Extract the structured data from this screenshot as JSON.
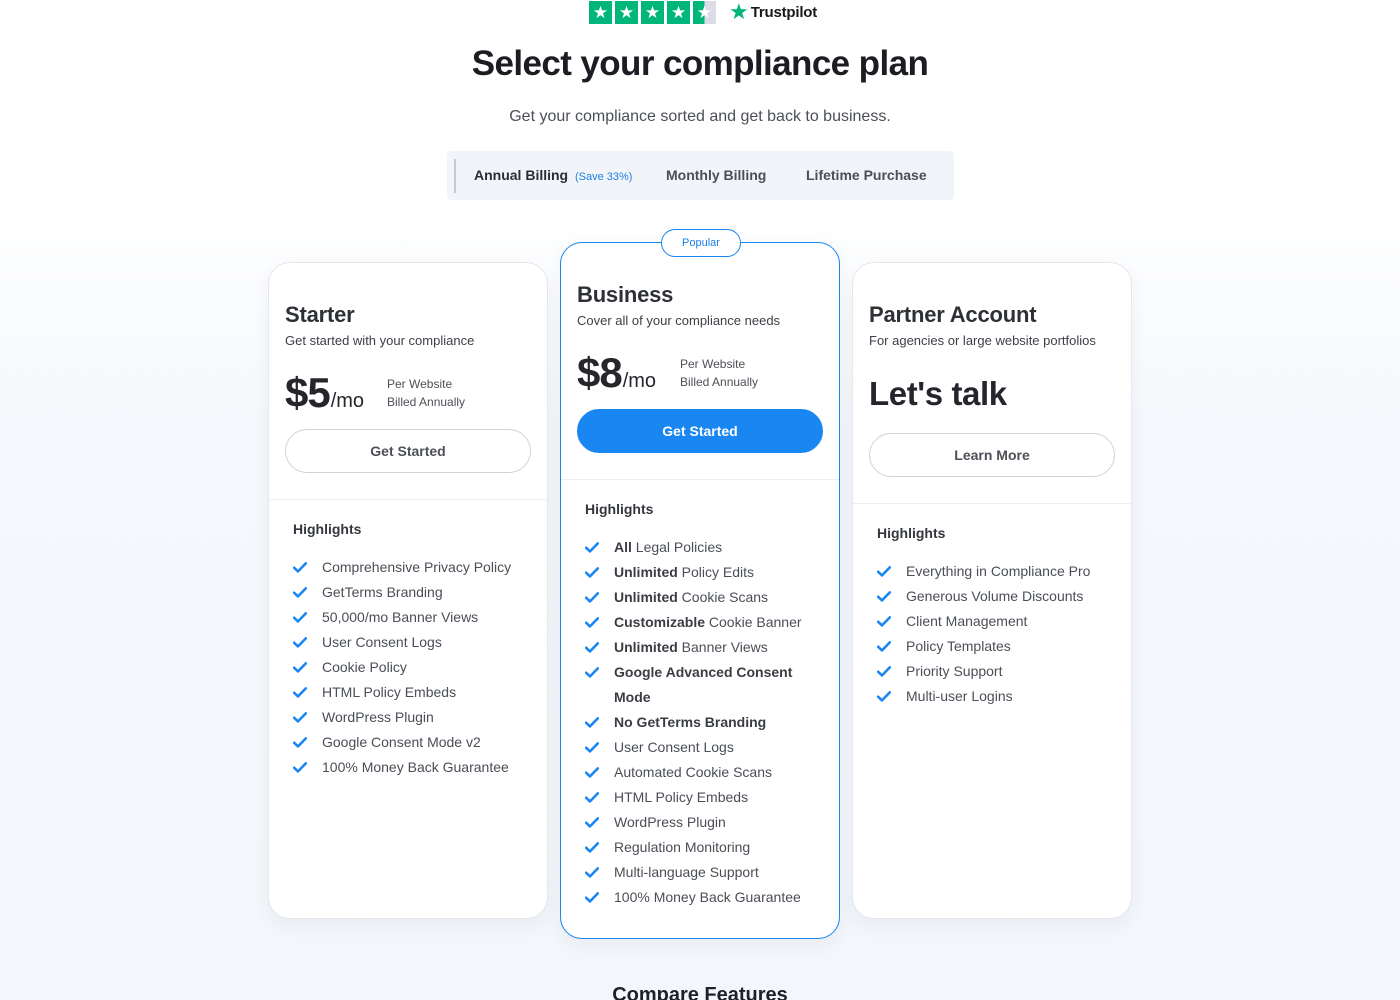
{
  "trustpilot": {
    "brand": "Trustpilot",
    "rating_stars": 4.5
  },
  "header": {
    "title": "Select your compliance plan",
    "subtitle": "Get your compliance sorted and get back to business."
  },
  "billing": {
    "tabs": [
      {
        "label": "Annual Billing",
        "badge": "(Save 33%)",
        "active": true
      },
      {
        "label": "Monthly Billing",
        "active": false
      },
      {
        "label": "Lifetime Purchase",
        "active": false
      }
    ]
  },
  "plans": [
    {
      "name": "Starter",
      "description": "Get started with your compliance",
      "price": "$5",
      "period": "/mo",
      "note_line1": "Per Website",
      "note_line2": "Billed Annually",
      "button": "Get Started",
      "highlights_title": "Highlights",
      "features": [
        {
          "bold": "",
          "text": "Comprehensive Privacy Policy"
        },
        {
          "bold": "",
          "text": "GetTerms Branding"
        },
        {
          "bold": "",
          "text": "50,000/mo Banner Views"
        },
        {
          "bold": "",
          "text": "User Consent Logs"
        },
        {
          "bold": "",
          "text": "Cookie Policy"
        },
        {
          "bold": "",
          "text": "HTML Policy Embeds"
        },
        {
          "bold": "",
          "text": "WordPress Plugin"
        },
        {
          "bold": "",
          "text": "Google Consent Mode v2"
        },
        {
          "bold": "",
          "text": "100% Money Back Guarantee"
        }
      ]
    },
    {
      "badge": "Popular",
      "name": "Business",
      "description": "Cover all of your compliance needs",
      "price": "$8",
      "period": "/mo",
      "note_line1": "Per Website",
      "note_line2": "Billed Annually",
      "button": "Get Started",
      "highlights_title": "Highlights",
      "features": [
        {
          "bold": "All",
          "text": " Legal Policies"
        },
        {
          "bold": "Unlimited",
          "text": " Policy Edits"
        },
        {
          "bold": "Unlimited",
          "text": " Cookie Scans"
        },
        {
          "bold": "Customizable",
          "text": " Cookie Banner"
        },
        {
          "bold": "Unlimited",
          "text": " Banner Views"
        },
        {
          "bold": "Google Advanced Consent Mode",
          "text": ""
        },
        {
          "bold": "No GetTerms Branding",
          "text": ""
        },
        {
          "bold": "",
          "text": "User Consent Logs"
        },
        {
          "bold": "",
          "text": "Automated Cookie Scans"
        },
        {
          "bold": "",
          "text": "HTML Policy Embeds"
        },
        {
          "bold": "",
          "text": "WordPress Plugin"
        },
        {
          "bold": "",
          "text": "Regulation Monitoring"
        },
        {
          "bold": "",
          "text": "Multi-language Support"
        },
        {
          "bold": "",
          "text": "100% Money Back Guarantee"
        }
      ]
    },
    {
      "name": "Partner Account",
      "description": "For agencies or large website portfolios",
      "headline": "Let's talk",
      "button": "Learn More",
      "highlights_title": "Highlights",
      "features": [
        {
          "bold": "",
          "text": "Everything in Compliance Pro"
        },
        {
          "bold": "",
          "text": "Generous Volume Discounts"
        },
        {
          "bold": "",
          "text": "Client Management"
        },
        {
          "bold": "",
          "text": "Policy Templates"
        },
        {
          "bold": "",
          "text": "Priority Support"
        },
        {
          "bold": "",
          "text": "Multi-user Logins"
        }
      ]
    }
  ],
  "compare": {
    "title": "Compare Features"
  },
  "colors": {
    "accent": "#1a86f2",
    "trustpilot_green": "#00b67a",
    "check": "#1a86f2"
  },
  "icons": {
    "feature_check": "check-icon",
    "trustpilot_star": "star-icon"
  }
}
